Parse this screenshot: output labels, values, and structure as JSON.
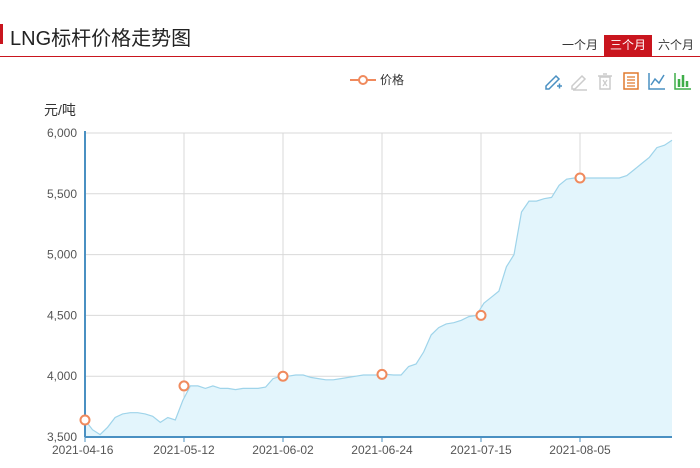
{
  "header": {
    "title": "LNG标杆价格走势图",
    "tabs": [
      {
        "label": "一个月",
        "active": false
      },
      {
        "label": "三个月",
        "active": true
      },
      {
        "label": "六个月",
        "active": false
      }
    ]
  },
  "colors": {
    "accent": "#c9151e",
    "line": "#9fd4ea",
    "area": "#e3f5fc",
    "marker": "#f08a5d",
    "axis": "#4a90c2",
    "grid": "#d9d9d9"
  },
  "toolbox": [
    {
      "icon": "edit-pencil-icon"
    },
    {
      "icon": "eraser-icon"
    },
    {
      "icon": "trash-icon"
    },
    {
      "icon": "data-view-icon"
    },
    {
      "icon": "line-chart-icon"
    },
    {
      "icon": "bar-chart-icon"
    }
  ],
  "chart_data": {
    "type": "area",
    "title": "LNG标杆价格走势图",
    "ylabel": "元/吨",
    "xlabel": "",
    "ylim": [
      3500,
      6000
    ],
    "yticks": [
      3500,
      4000,
      4500,
      5000,
      5500,
      6000
    ],
    "ytick_labels": [
      "3,500",
      "4,000",
      "4,500",
      "5,000",
      "5,500",
      "6,000"
    ],
    "xtick_labels": [
      "2021-04-16",
      "2021-05-12",
      "2021-06-02",
      "2021-06-24",
      "2021-07-15",
      "2021-08-05"
    ],
    "grid": true,
    "legend": "top-center",
    "series": [
      {
        "name": "价格",
        "values": [
          3640,
          3560,
          3520,
          3580,
          3660,
          3690,
          3700,
          3700,
          3690,
          3670,
          3620,
          3660,
          3640,
          3800,
          3920,
          3920,
          3900,
          3920,
          3900,
          3900,
          3890,
          3900,
          3900,
          3900,
          3910,
          3980,
          4000,
          4000,
          4010,
          4010,
          3990,
          3980,
          3970,
          3970,
          3980,
          3990,
          4000,
          4010,
          4010,
          4010,
          4015,
          4010,
          4010,
          4080,
          4100,
          4200,
          4340,
          4400,
          4430,
          4440,
          4460,
          4490,
          4500,
          4600,
          4650,
          4700,
          4900,
          5000,
          5350,
          5440,
          5440,
          5460,
          5470,
          5570,
          5620,
          5630,
          5630,
          5630,
          5630,
          5630,
          5630,
          5630,
          5650,
          5700,
          5750,
          5800,
          5880,
          5900,
          5940
        ]
      }
    ],
    "marked_points": [
      {
        "x": "2021-04-16",
        "y": 3640
      },
      {
        "x": "2021-05-12",
        "y": 3920
      },
      {
        "x": "2021-06-02",
        "y": 4000
      },
      {
        "x": "2021-06-24",
        "y": 4015
      },
      {
        "x": "2021-07-15",
        "y": 4500
      },
      {
        "x": "2021-08-05",
        "y": 5630
      }
    ]
  }
}
